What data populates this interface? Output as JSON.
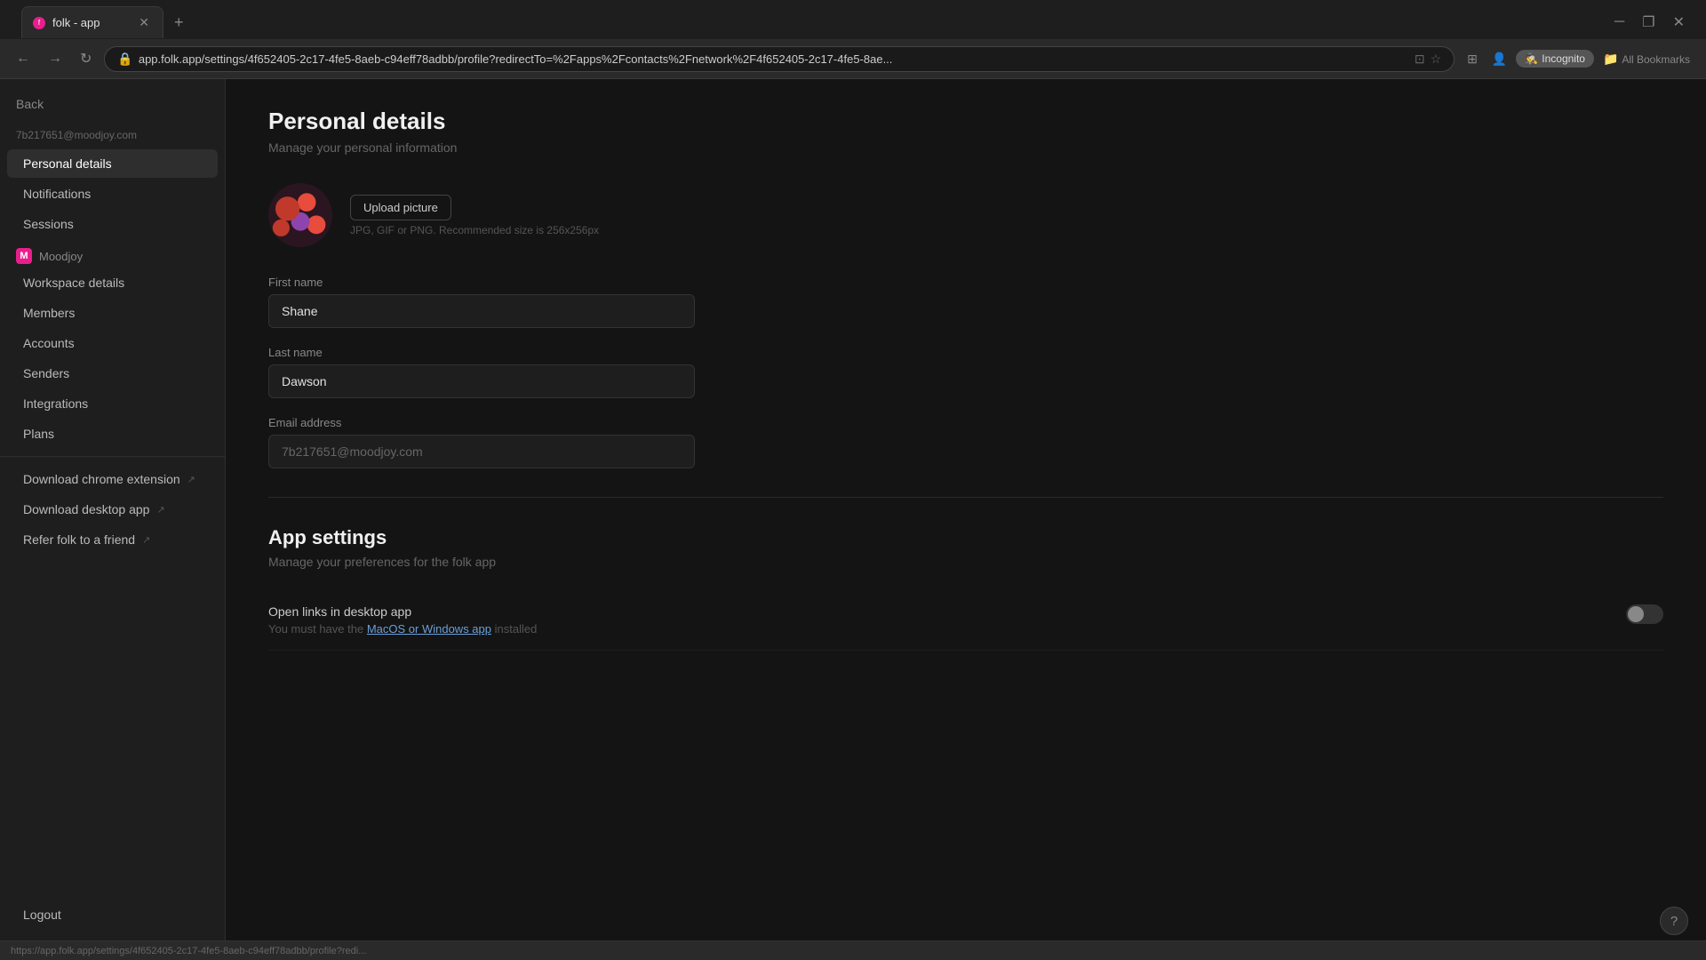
{
  "browser": {
    "tab_title": "folk - app",
    "tab_favicon": "f",
    "address": "app.folk.app/settings/4f652405-2c17-4fe5-8aeb-c94eff78adbb/profile?redirectTo=%2Fapps%2Fcontacts%2Fnetwork%2F4f652405-2c17-4fe5-8ae...",
    "incognito_label": "Incognito",
    "bookmarks_label": "All Bookmarks",
    "status_url": "https://app.folk.app/settings/4f652405-2c17-4fe5-8aeb-c94eff78adbb/profile?redi..."
  },
  "sidebar": {
    "back_label": "Back",
    "email": "7b217651@moodjoy.com",
    "personal_details_label": "Personal details",
    "notifications_label": "Notifications",
    "sessions_label": "Sessions",
    "workspace_name": "Moodjoy",
    "workspace_badge": "M",
    "workspace_details_label": "Workspace details",
    "members_label": "Members",
    "accounts_label": "Accounts",
    "senders_label": "Senders",
    "integrations_label": "Integrations",
    "plans_label": "Plans",
    "download_chrome_label": "Download chrome extension",
    "download_desktop_label": "Download desktop app",
    "refer_label": "Refer folk to a friend",
    "logout_label": "Logout"
  },
  "main": {
    "page_title": "Personal details",
    "page_subtitle": "Manage your personal information",
    "upload_btn_label": "Upload picture",
    "avatar_hint": "JPG, GIF or PNG. Recommended size is 256x256px",
    "first_name_label": "First name",
    "first_name_value": "Shane",
    "last_name_label": "Last name",
    "last_name_value": "Dawson",
    "email_label": "Email address",
    "email_value": "7b217651@moodjoy.com",
    "app_settings_title": "App settings",
    "app_settings_subtitle": "Manage your preferences for the folk app",
    "open_links_label": "Open links in desktop app",
    "open_links_desc_prefix": "You must have the ",
    "open_links_link": "MacOS or Windows app",
    "open_links_desc_suffix": " installed"
  },
  "icons": {
    "back": "←",
    "external": "↗",
    "help": "?"
  }
}
